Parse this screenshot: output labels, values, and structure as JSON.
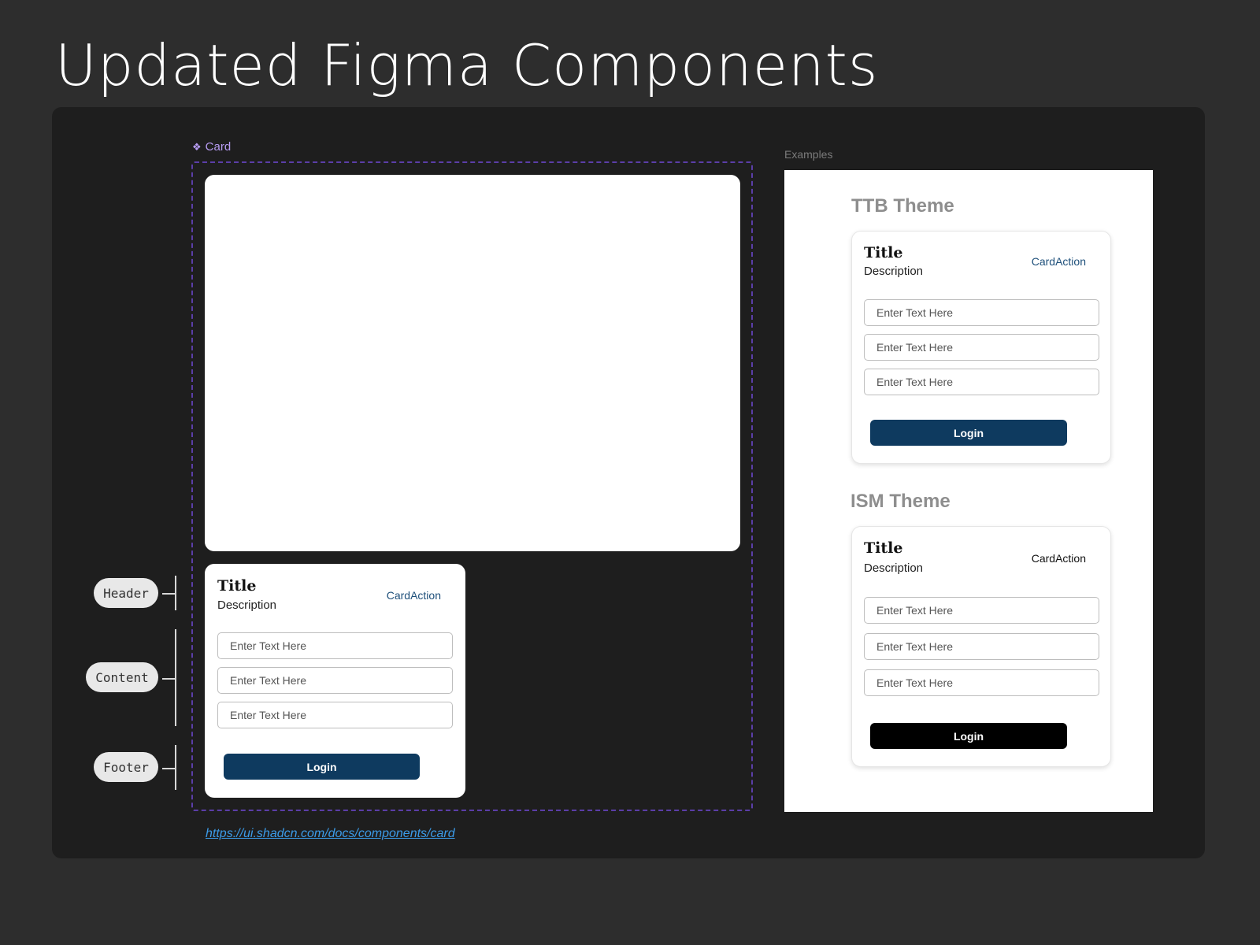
{
  "page": {
    "title": "Updated Figma Components"
  },
  "component": {
    "label": "Card",
    "icon": "component-diamond-icon",
    "accent_color": "#b79cf3",
    "frame_color": "#5b3ea8"
  },
  "annotations": {
    "header": "Header",
    "content": "Content",
    "footer": "Footer"
  },
  "main_card": {
    "title": "Title",
    "description": "Description",
    "action": "CardAction",
    "fields": [
      "Enter Text Here",
      "Enter Text Here",
      "Enter Text Here"
    ],
    "button": "Login",
    "button_color": "#0e3a5f",
    "action_color": "#1d4f7a"
  },
  "link": {
    "url": "https://ui.shadcn.com/docs/components/card"
  },
  "examples": {
    "label": "Examples",
    "ttb": {
      "theme": "TTB Theme",
      "title": "Title",
      "description": "Description",
      "action": "CardAction",
      "fields": [
        "Enter Text Here",
        "Enter Text Here",
        "Enter Text Here"
      ],
      "button": "Login",
      "button_color": "#0e3a5f",
      "action_color": "#1d4f7a"
    },
    "ism": {
      "theme": "ISM Theme",
      "title": "Title",
      "description": "Description",
      "action": "CardAction",
      "fields": [
        "Enter Text Here",
        "Enter Text Here",
        "Enter Text Here"
      ],
      "button": "Login",
      "button_color": "#000000",
      "action_color": "#111111"
    }
  }
}
